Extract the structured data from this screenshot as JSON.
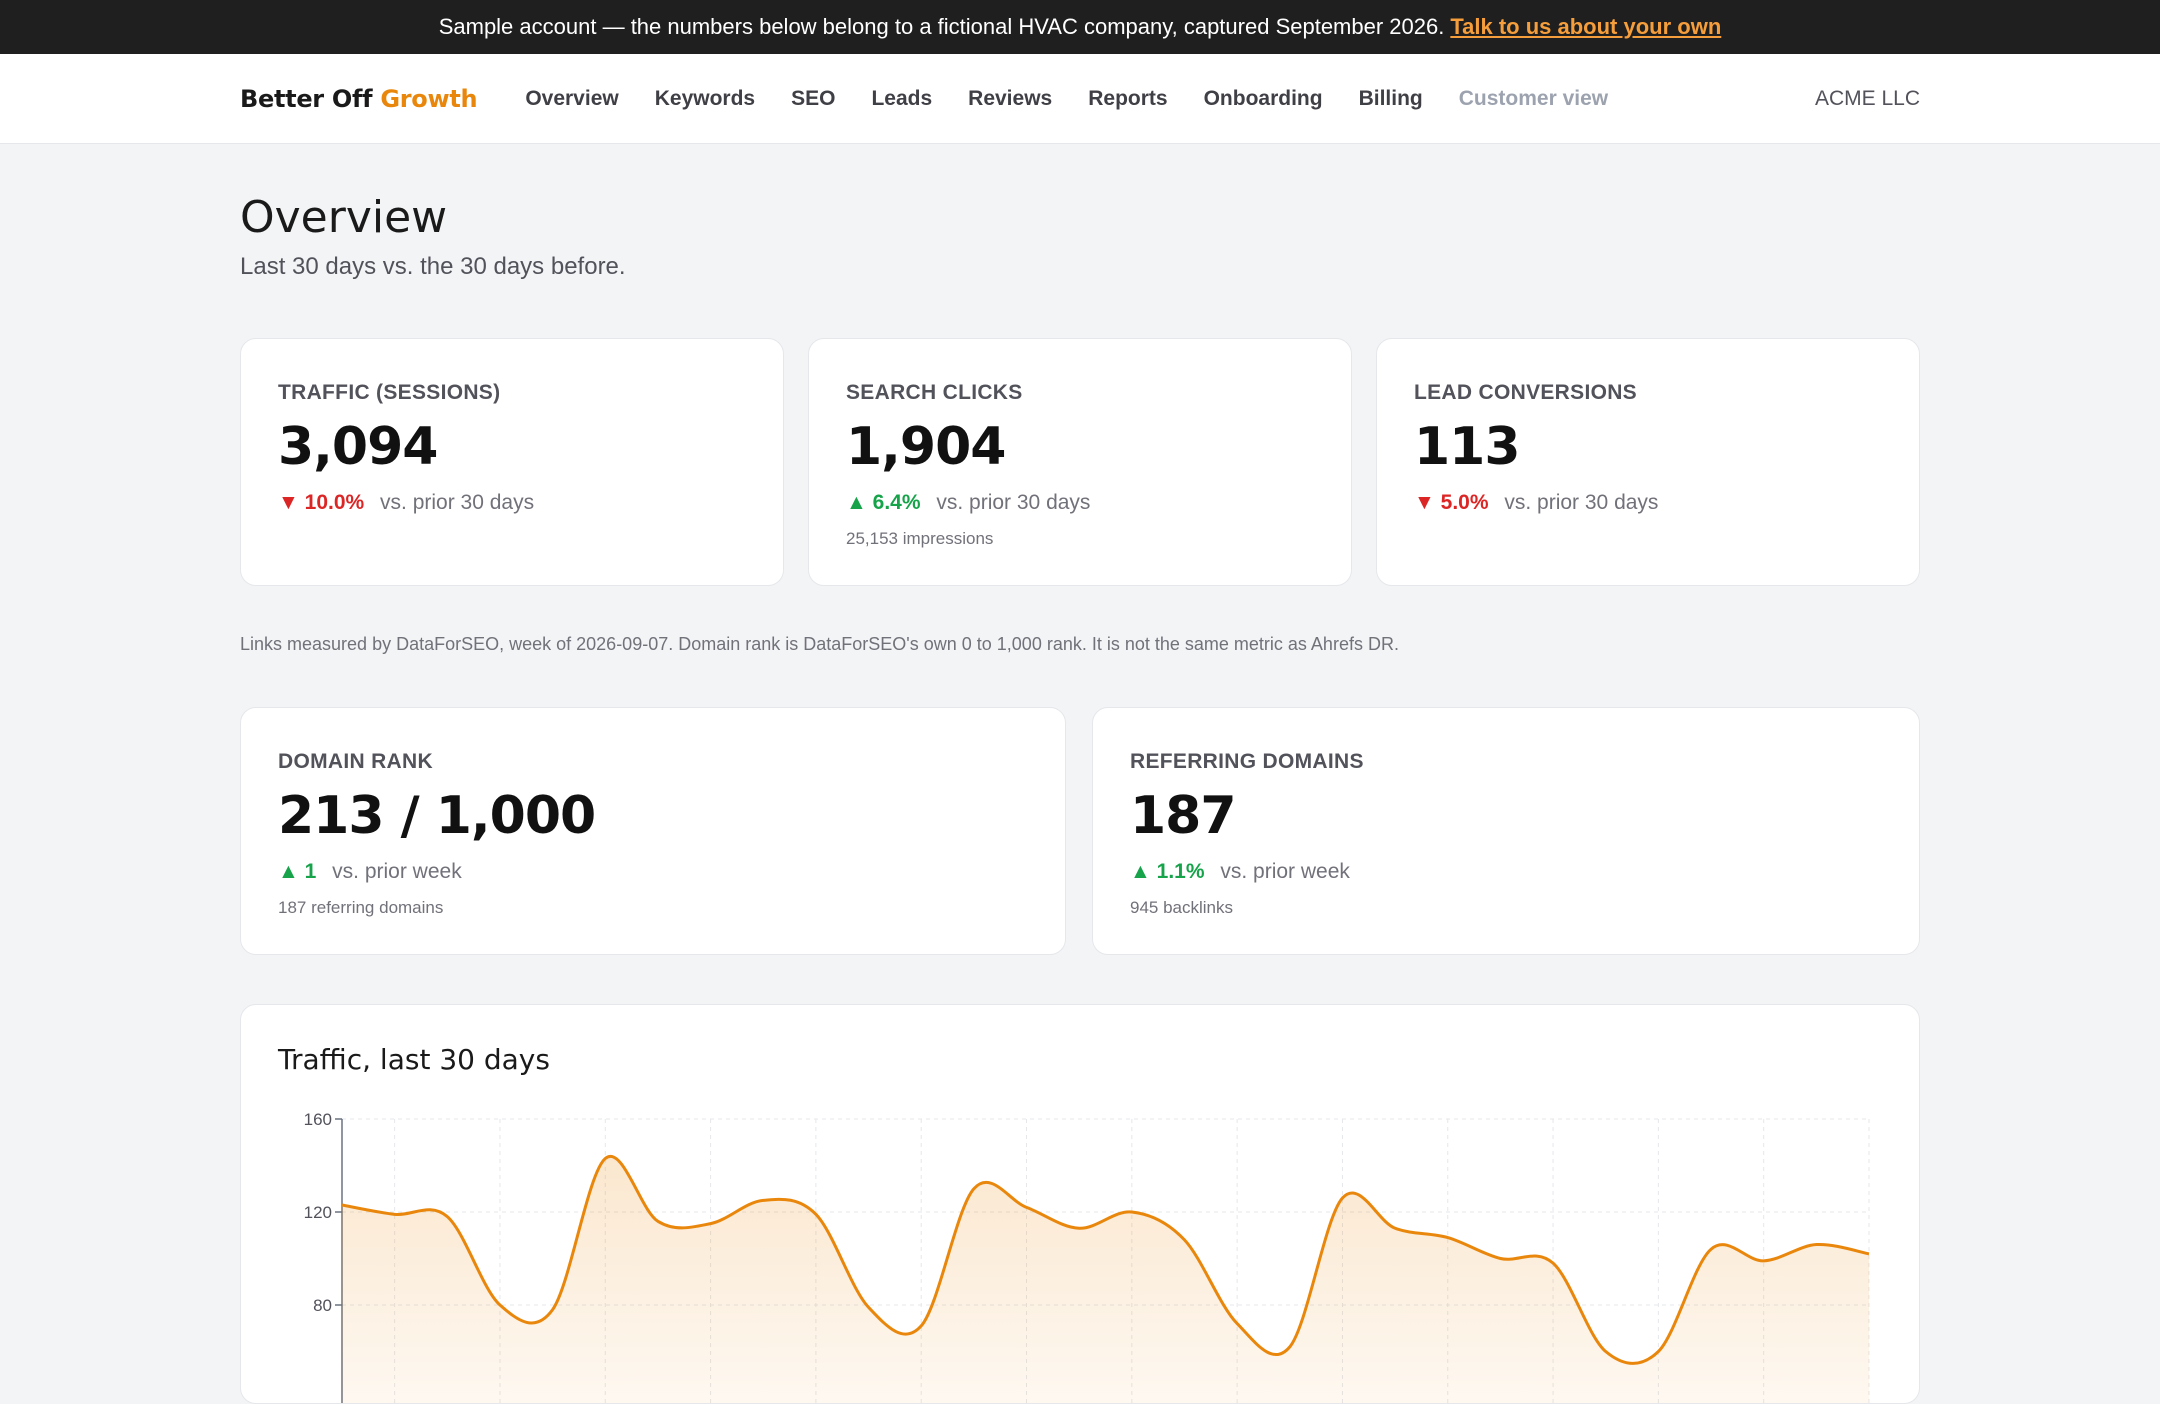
{
  "banner": {
    "text": "Sample account — the numbers below belong to a fictional HVAC company, captured September 2026.",
    "link": "Talk to us about your own"
  },
  "nav": {
    "brand_main": "Better Off",
    "brand_accent": "Growth",
    "links": [
      "Overview",
      "Keywords",
      "SEO",
      "Leads",
      "Reviews",
      "Reports",
      "Onboarding",
      "Billing"
    ],
    "customer_view": "Customer view",
    "account": "ACME LLC"
  },
  "page": {
    "title": "Overview",
    "subtitle": "Last 30 days vs. the 30 days before."
  },
  "metrics": [
    {
      "label": "TRAFFIC (SESSIONS)",
      "value": "3,094",
      "arrow": "▼",
      "delta": "10.0%",
      "direction": "down",
      "comparison": "vs. prior 30 days",
      "note": ""
    },
    {
      "label": "SEARCH CLICKS",
      "value": "1,904",
      "arrow": "▲",
      "delta": "6.4%",
      "direction": "up",
      "comparison": "vs. prior 30 days",
      "note": "25,153 impressions"
    },
    {
      "label": "LEAD CONVERSIONS",
      "value": "113",
      "arrow": "▼",
      "delta": "5.0%",
      "direction": "down",
      "comparison": "vs. prior 30 days",
      "note": ""
    }
  ],
  "links_note": "Links measured by DataForSEO, week of 2026-09-07. Domain rank is DataForSEO's own 0 to 1,000 rank. It is not the same metric as Ahrefs DR.",
  "link_metrics": [
    {
      "label": "DOMAIN RANK",
      "value": "213 / 1,000",
      "arrow": "▲",
      "delta": "1",
      "direction": "up",
      "comparison": "vs. prior week",
      "note": "187 referring domains"
    },
    {
      "label": "REFERRING DOMAINS",
      "value": "187",
      "arrow": "▲",
      "delta": "1.1%",
      "direction": "up",
      "comparison": "vs. prior week",
      "note": "945 backlinks"
    }
  ],
  "colors": {
    "accent": "#e9870c",
    "up": "#16a34a",
    "down": "#dc2626",
    "banner_bg": "#1f1f1f",
    "banner_link": "#f59e3b"
  },
  "chart_data": {
    "type": "area",
    "title": "Traffic, last 30 days",
    "xlabel": "",
    "ylabel": "",
    "ylim": [
      0,
      160
    ],
    "yticks": [
      80,
      120,
      160
    ],
    "grid": true,
    "x": [
      1,
      2,
      3,
      4,
      5,
      6,
      7,
      8,
      9,
      10,
      11,
      12,
      13,
      14,
      15,
      16,
      17,
      18,
      19,
      20,
      21,
      22,
      23,
      24,
      25,
      26,
      27,
      28,
      29,
      30
    ],
    "values": [
      123,
      119,
      118,
      80,
      78,
      143,
      116,
      115,
      125,
      119,
      79,
      71,
      130,
      122,
      113,
      120,
      108,
      72,
      62,
      126,
      113,
      109,
      100,
      98,
      60,
      60,
      104,
      99,
      106,
      102
    ]
  }
}
